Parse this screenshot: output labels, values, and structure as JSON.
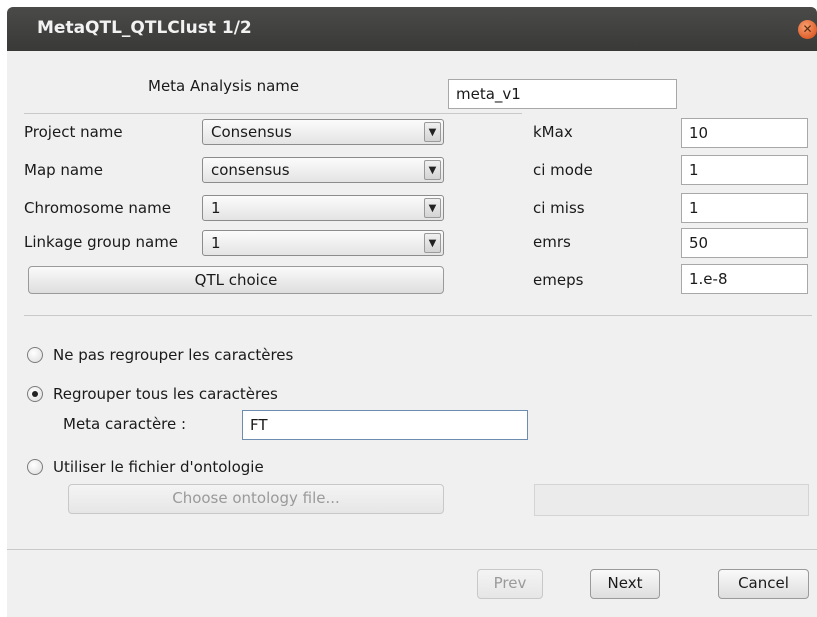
{
  "window": {
    "title": "MetaQTL_QTLClust 1/2"
  },
  "meta": {
    "label": "Meta Analysis name",
    "value": "meta_v1"
  },
  "fields": {
    "project": {
      "label": "Project name",
      "value": "Consensus"
    },
    "map": {
      "label": "Map name",
      "value": "consensus"
    },
    "chromosome": {
      "label": "Chromosome name",
      "value": "1"
    },
    "linkage": {
      "label": "Linkage group name",
      "value": "1"
    }
  },
  "params": {
    "kmax": {
      "label": "kMax",
      "value": "10"
    },
    "ci_mode": {
      "label": "ci mode",
      "value": "1"
    },
    "ci_miss": {
      "label": "ci miss",
      "value": "1"
    },
    "emrs": {
      "label": "emrs",
      "value": "50"
    },
    "emeps": {
      "label": "emeps",
      "value": "1.e-8"
    }
  },
  "qtl_choice_label": "QTL choice",
  "options": {
    "no_group": "Ne pas regrouper les caractères",
    "group_all": "Regrouper tous les caractères",
    "meta_char_label": "Meta caractère :",
    "meta_char_value": "FT",
    "ontology": "Utiliser le fichier d'ontologie",
    "choose_ontology": "Choose ontology file...",
    "selected": "group_all"
  },
  "buttons": {
    "prev": "Prev",
    "next": "Next",
    "cancel": "Cancel"
  }
}
